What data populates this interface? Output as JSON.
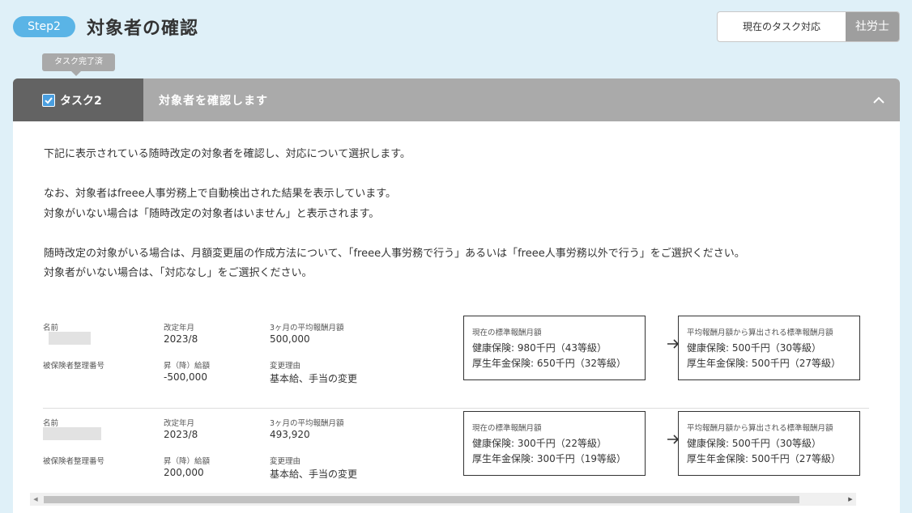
{
  "header": {
    "step_label": "Step2",
    "title": "対象者の確認",
    "role_label": "現在のタスク対応",
    "role_value": "社労士"
  },
  "tooltip": "タスク完了済",
  "task": {
    "tab_label": "タスク2",
    "title": "対象者を確認します",
    "completed": true
  },
  "description": {
    "line1": "下記に表示されている随時改定の対象者を確認し、対応について選択します。",
    "line2": "なお、対象者はfreee人事労務上で自動検出された結果を表示しています。",
    "line3": "対象がいない場合は「随時改定の対象者はいません」と表示されます。",
    "line4": "随時改定の対象がいる場合は、月額変更届の作成方法について、「freee人事労務で行う」あるいは「freee人事労務以外で行う」をご選択ください。",
    "line5": "対象者がいない場合は、「対応なし」をご選択ください。"
  },
  "labels": {
    "name": "名前",
    "insured_number": "被保険者整理番号",
    "revision_month": "改定年月",
    "raise": "昇（降）給額",
    "avg_salary": "3ヶ月の平均報酬月額",
    "reason": "変更理由",
    "current_grade": "現在の標準報酬月額",
    "calculated_grade": "平均報酬月額から算出される標準報酬月額"
  },
  "rows": [
    {
      "revision_month": "2023/8",
      "raise": "-500,000",
      "avg_salary": "500,000",
      "reason": "基本給、手当の変更",
      "current_health": "健康保険: 980千円（43等級）",
      "current_pension": "厚生年金保険: 650千円（32等級）",
      "new_health": "健康保険: 500千円（30等級）",
      "new_pension": "厚生年金保険: 500千円（27等級）"
    },
    {
      "revision_month": "2023/8",
      "raise": "200,000",
      "avg_salary": "493,920",
      "reason": "基本給、手当の変更",
      "current_health": "健康保険: 300千円（22等級）",
      "current_pension": "厚生年金保険: 300千円（19等級）",
      "new_health": "健康保険: 500千円（30等級）",
      "new_pension": "厚生年金保険: 500千円（27等級）"
    }
  ],
  "colors": {
    "background": "#dff0f8",
    "step_pill": "#5ab4e6",
    "task_tab": "#636363",
    "header_bar": "#aaaaaa",
    "check": "#4a9fe0"
  },
  "icons": {
    "check": "check-icon",
    "collapse": "chevron-up-icon",
    "arrow": "arrow-right-icon"
  }
}
